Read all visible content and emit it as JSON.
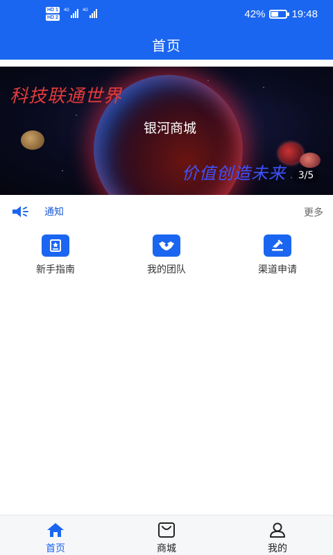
{
  "status_bar": {
    "hd1": "HD 1",
    "hd2": "HD 2",
    "net1": "4G",
    "net2": "4G",
    "battery": "42%",
    "battery_level": 0.42,
    "time": "19:48"
  },
  "header": {
    "title": "首页"
  },
  "banner": {
    "slogan_left": "科技联通世界",
    "slogan_right": "价值创造未来",
    "title": "银河商城",
    "counter": "3/5"
  },
  "notice": {
    "label": "通知",
    "more": "更多"
  },
  "quick_menu": [
    {
      "label": "新手指南",
      "icon": "guide-icon"
    },
    {
      "label": "我的团队",
      "icon": "handshake-icon"
    },
    {
      "label": "渠道申请",
      "icon": "channel-icon"
    }
  ],
  "bottom_nav": [
    {
      "label": "首页",
      "icon": "home-icon",
      "active": true
    },
    {
      "label": "商城",
      "icon": "shopping-bag-icon",
      "active": false
    },
    {
      "label": "我的",
      "icon": "user-icon",
      "active": false
    }
  ],
  "colors": {
    "primary": "#1b66f0",
    "background": "#ffffff",
    "nav_bg": "#f6f7f9"
  }
}
